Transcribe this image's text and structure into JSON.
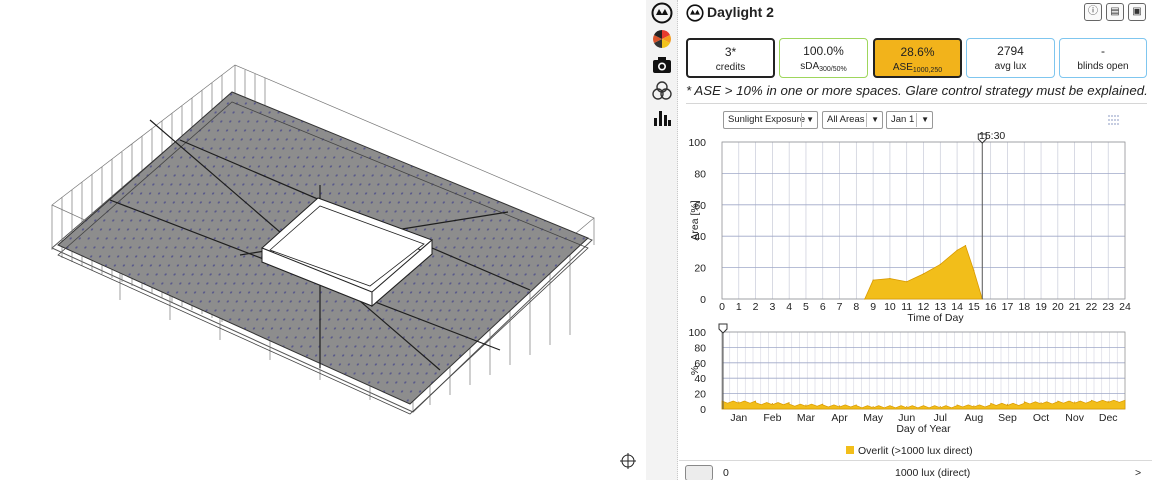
{
  "panel": {
    "title": "Daylight 2",
    "header_buttons": [
      "info-icon",
      "save-icon",
      "export-icon"
    ]
  },
  "metrics": [
    {
      "value": "3*",
      "label": "credits",
      "sub": "",
      "border": "#222222",
      "fill": "#ffffff"
    },
    {
      "value": "100.0%",
      "label": "sDA",
      "sub": "300/50%",
      "border": "#9ed65c",
      "fill": "#ffffff"
    },
    {
      "value": "28.6%",
      "label": "ASE",
      "sub": "1000,250",
      "border": "#222222",
      "fill": "#f2b31b"
    },
    {
      "value": "2794",
      "label": "avg lux",
      "sub": "",
      "border": "#7fc6ef",
      "fill": "#ffffff"
    },
    {
      "value": "-",
      "label": "blinds open",
      "sub": "",
      "border": "#7fc6ef",
      "fill": "#ffffff"
    }
  ],
  "note": "* ASE > 10% in one or more spaces. Glare control strategy must be explained.",
  "controls": {
    "metric_select": "Sunlight Exposure",
    "area_select": "All Areas",
    "date_select": "Jan 1"
  },
  "time_marker": "15:30",
  "colors": {
    "accent": "#f2be1a",
    "area_fill": "#f2be1a",
    "area_stroke": "#d99a00",
    "grid": "#9fa8c8"
  },
  "chart_data": [
    {
      "type": "area",
      "xlabel": "Time of Day",
      "ylabel": "Area [%]",
      "xlim": [
        0,
        24
      ],
      "ylim": [
        0,
        100
      ],
      "x_ticks": [
        0,
        1,
        2,
        3,
        4,
        5,
        6,
        7,
        8,
        9,
        10,
        11,
        12,
        13,
        14,
        15,
        16,
        17,
        18,
        19,
        20,
        21,
        22,
        23,
        24
      ],
      "y_ticks": [
        0,
        20,
        40,
        60,
        80,
        100
      ],
      "x": [
        8.5,
        9.0,
        10.0,
        11.0,
        12.0,
        13.0,
        14.0,
        14.5,
        15.0,
        15.5
      ],
      "values": [
        0,
        12,
        13,
        11,
        16,
        22,
        31,
        34,
        18,
        0
      ],
      "marker_x": 15.5
    },
    {
      "type": "area",
      "xlabel": "Day of Year",
      "ylabel": "%",
      "ylim": [
        0,
        100
      ],
      "y_ticks": [
        0,
        20,
        40,
        60,
        80,
        100
      ],
      "categories": [
        "Jan",
        "Feb",
        "Mar",
        "Apr",
        "May",
        "Jun",
        "Jul",
        "Aug",
        "Sep",
        "Oct",
        "Nov",
        "Dec"
      ],
      "series": [
        {
          "name": "Overlit (>1000 lux direct)",
          "values": [
            9,
            7,
            5,
            4,
            3,
            3,
            3,
            4,
            6,
            8,
            9,
            10
          ]
        }
      ],
      "marker_day": 1
    }
  ],
  "legend": {
    "label": "Overlit (>1000 lux direct)"
  },
  "footer": {
    "min_value": "0",
    "mid_label": "1000 lux (direct)",
    "more": ">"
  }
}
